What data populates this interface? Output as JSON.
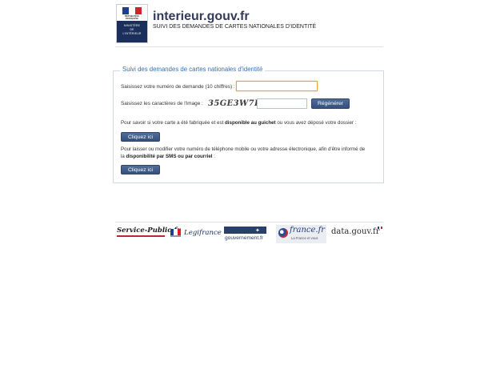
{
  "header": {
    "logo": {
      "republic_text": "RÉPUBLIQUE FRANÇAISE",
      "ministry_text": [
        "MINISTÈRE",
        "DE",
        "L'INTÉRIEUR"
      ],
      "flag_colors": [
        "#1f3f8e",
        "#ffffff",
        "#d81e2a"
      ]
    },
    "site_title": "interieur.gouv.fr",
    "subtitle": "SUIVI DES DEMANDES DE CARTES NATIONALES D'IDENTITÉ"
  },
  "form": {
    "legend": "Suivi des demandes de cartes nationales d'identité",
    "request_label": "Saisissez votre numéro de demande (10 chiffres) :",
    "request_value": "",
    "captcha_label": "Saisissez les caractères de l'image :",
    "captcha_image_text": "35GE3W7E",
    "captcha_value": "",
    "regenerate_label": "Régénérer",
    "para1_prefix": "Pour savoir si votre carte a été fabriquée et est ",
    "para1_bold": "disponible au guichet",
    "para1_suffix": " ou vous avez déposé votre dossier :",
    "button1_label": "Cliquez ici",
    "para2_line1": "Pour laisser ou modifier votre numéro de téléphone mobile ou votre adresse électronique, afin d'être informé de",
    "para2_prefix": "la ",
    "para2_bold": "disponibilité par SMS ou par courriel",
    "para2_suffix": " :",
    "button2_label": "Cliquez ici"
  },
  "footer": {
    "logos": {
      "service_public": "Service-Public",
      "service_public_suffix": ".fr",
      "legifrance": "Legifrance",
      "gouvernement": "gouvernement.fr",
      "france_fr": "france.fr",
      "france_fr_tagline": "La France et vous",
      "data_gouv": "data.gouv.fr"
    }
  },
  "colors": {
    "brand_navy": "#1a2f5c",
    "legend_blue": "#3a6fae",
    "button_blue": "#3f5c88",
    "focus_orange": "#e9a43b"
  }
}
